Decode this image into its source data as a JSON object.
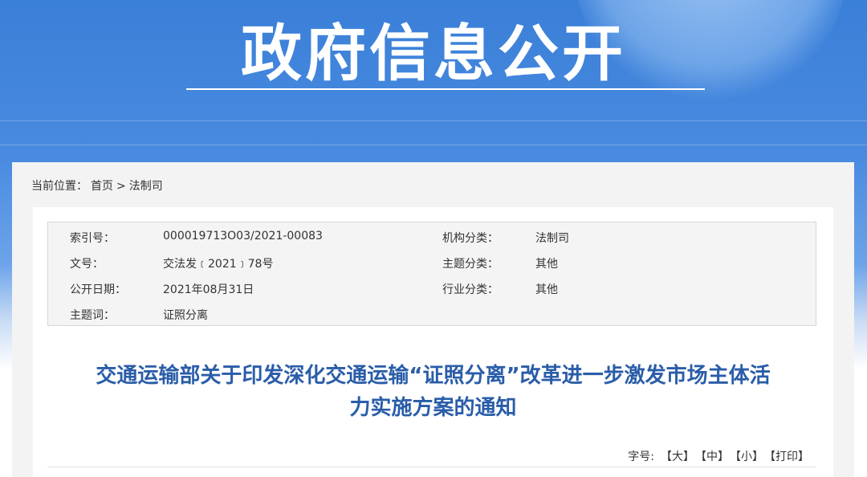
{
  "banner": {
    "title": "政府信息公开"
  },
  "breadcrumb": {
    "prefix": "当前位置：",
    "home": "首页",
    "sep": ">",
    "current": "法制司"
  },
  "meta": {
    "rows": [
      {
        "label1": "索引号：",
        "value1": "000019713O03/2021-00083",
        "label2": "机构分类：",
        "value2": "法制司"
      },
      {
        "label1": "文号：",
        "value1": "交法发﹝2021﹞78号",
        "label2": "主题分类：",
        "value2": "其他"
      },
      {
        "label1": "公开日期：",
        "value1": "2021年08月31日",
        "label2": "行业分类：",
        "value2": "其他"
      },
      {
        "label1": "主题词：",
        "value1": "证照分离",
        "label2": "",
        "value2": ""
      }
    ]
  },
  "document": {
    "title_line1": "交通运输部关于印发深化交通运输“证照分离”改革进一步激发市场主体活",
    "title_line2": "力实施方案的通知"
  },
  "font_size_controls": {
    "label": "字号:",
    "large": "【大】",
    "medium": "【中】",
    "small": "【小】",
    "print": "【打印】"
  }
}
